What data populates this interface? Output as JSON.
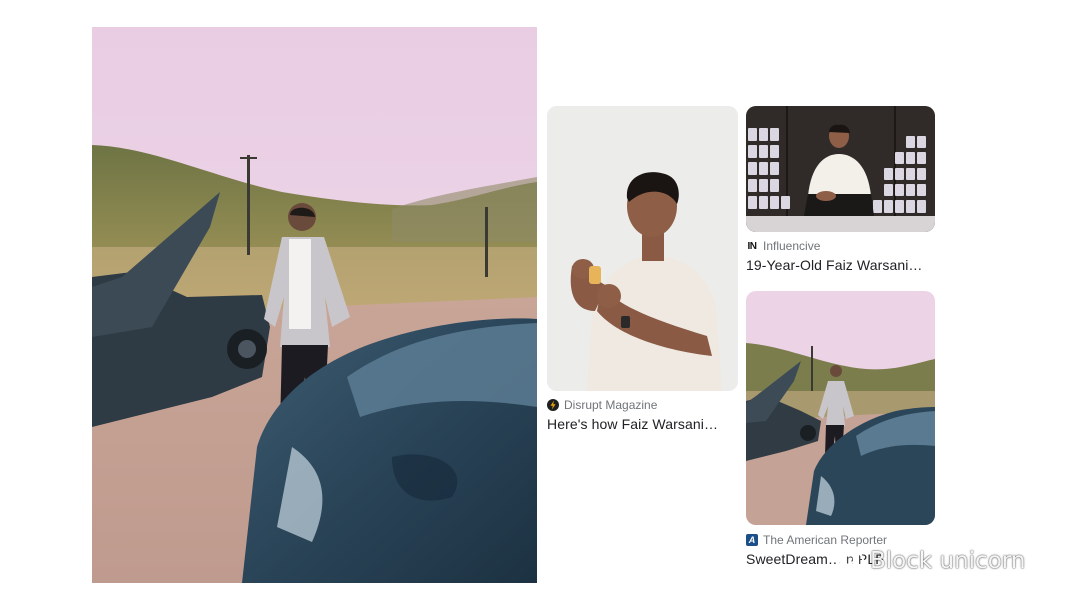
{
  "hero": {
    "image_icon": "photo-of-man-with-sports-cars"
  },
  "results": [
    {
      "source": "Disrupt Magazine",
      "favicon": "lightning-bolt-icon",
      "favicon_color": "#e7a512",
      "title": "Here's how Faiz Warsani…"
    },
    {
      "source": "Influencive",
      "favicon": "in-logo-icon",
      "favicon_color": "#111111",
      "favicon_text": "IN",
      "title": "19-Year-Old Faiz Warsani…"
    },
    {
      "source": "The American Reporter",
      "favicon": "a-logo-icon",
      "favicon_color": "#1b4f8a",
      "favicon_text": "A",
      "title": "SweetDream… n PLF"
    }
  ],
  "watermark": {
    "text": "Block unicorn",
    "icon": "wechat-icon"
  }
}
